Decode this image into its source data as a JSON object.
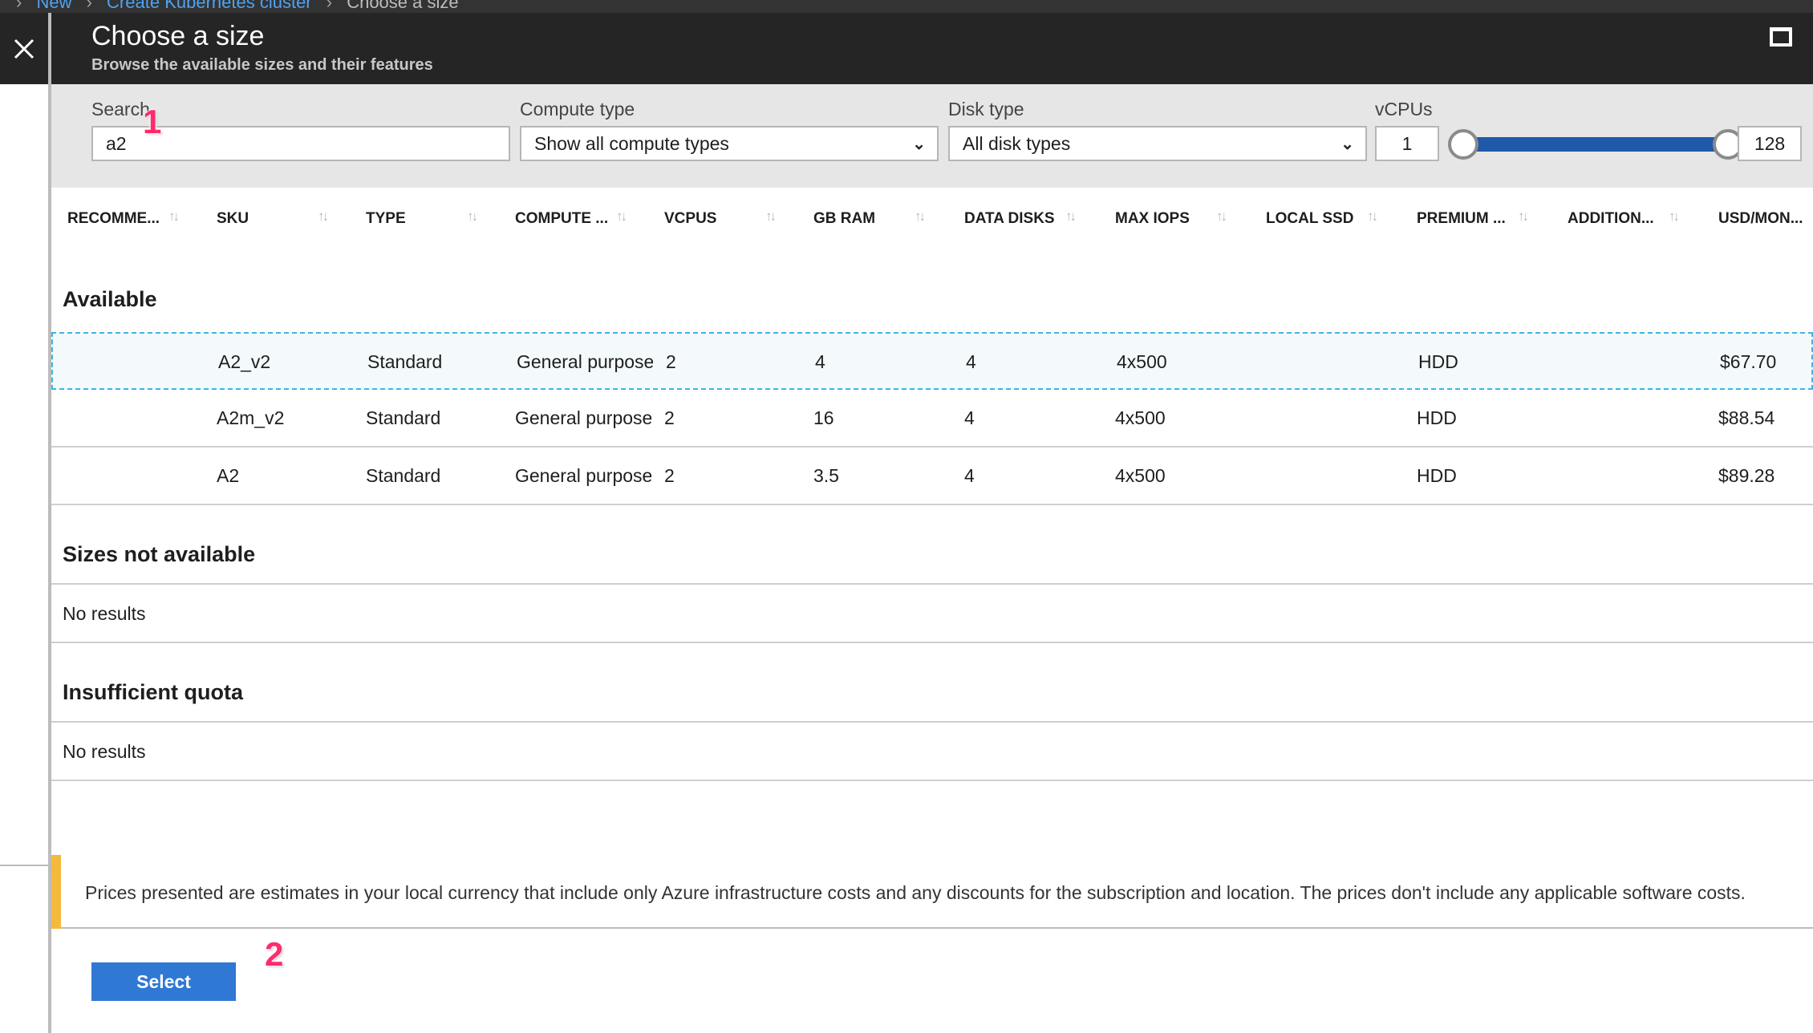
{
  "breadcrumb": {
    "items": [
      {
        "label": "New",
        "link": true
      },
      {
        "label": "Create Kubernetes cluster",
        "link": true
      },
      {
        "label": "Choose a size",
        "link": false
      }
    ]
  },
  "header": {
    "title": "Choose a size",
    "subtitle": "Browse the available sizes and their features",
    "close_icon": "close-icon",
    "maximize_icon": "maximize-icon"
  },
  "filters": {
    "search": {
      "label": "Search",
      "value": "a2"
    },
    "compute_type": {
      "label": "Compute type",
      "value": "Show all compute types"
    },
    "disk_type": {
      "label": "Disk type",
      "value": "All disk types"
    },
    "vcpus": {
      "label": "vCPUs",
      "min": "1",
      "max": "128",
      "range_low_fraction": 0.0,
      "range_high_fraction": 1.0
    }
  },
  "table": {
    "columns": [
      "RECOMME...",
      "SKU",
      "TYPE",
      "COMPUTE ...",
      "VCPUS",
      "GB RAM",
      "DATA DISKS",
      "MAX IOPS",
      "LOCAL SSD",
      "PREMIUM ...",
      "ADDITION...",
      "USD/MON..."
    ],
    "sections": {
      "available": {
        "title": "Available",
        "rows": [
          {
            "recommended": "",
            "sku": "A2_v2",
            "type": "Standard",
            "compute": "General purpose",
            "vcpus": "2",
            "gb_ram": "4",
            "data_disks": "4",
            "max_iops": "4x500",
            "local_ssd": "",
            "premium": "HDD",
            "additional": "",
            "usd_month": "$67.70",
            "selected": true
          },
          {
            "recommended": "",
            "sku": "A2m_v2",
            "type": "Standard",
            "compute": "General purpose",
            "vcpus": "2",
            "gb_ram": "16",
            "data_disks": "4",
            "max_iops": "4x500",
            "local_ssd": "",
            "premium": "HDD",
            "additional": "",
            "usd_month": "$88.54",
            "selected": false
          },
          {
            "recommended": "",
            "sku": "A2",
            "type": "Standard",
            "compute": "General purpose",
            "vcpus": "2",
            "gb_ram": "3.5",
            "data_disks": "4",
            "max_iops": "4x500",
            "local_ssd": "",
            "premium": "HDD",
            "additional": "",
            "usd_month": "$89.28",
            "selected": false
          }
        ]
      },
      "not_available": {
        "title": "Sizes not available",
        "empty_text": "No results"
      },
      "insufficient_quota": {
        "title": "Insufficient quota",
        "empty_text": "No results"
      }
    }
  },
  "notice": {
    "text": "Prices presented are estimates in your local currency that include only Azure infrastructure costs and any discounts for the subscription and location. The prices don't include any applicable software costs.",
    "accent_color": "#f5b93d"
  },
  "footer": {
    "select_label": "Select"
  },
  "callouts": [
    "1",
    "2"
  ],
  "colors": {
    "header_bg": "#252525",
    "accent_blue": "#2f78d3",
    "slider_fill": "#2059a9",
    "callout": "#ff2a6d"
  }
}
